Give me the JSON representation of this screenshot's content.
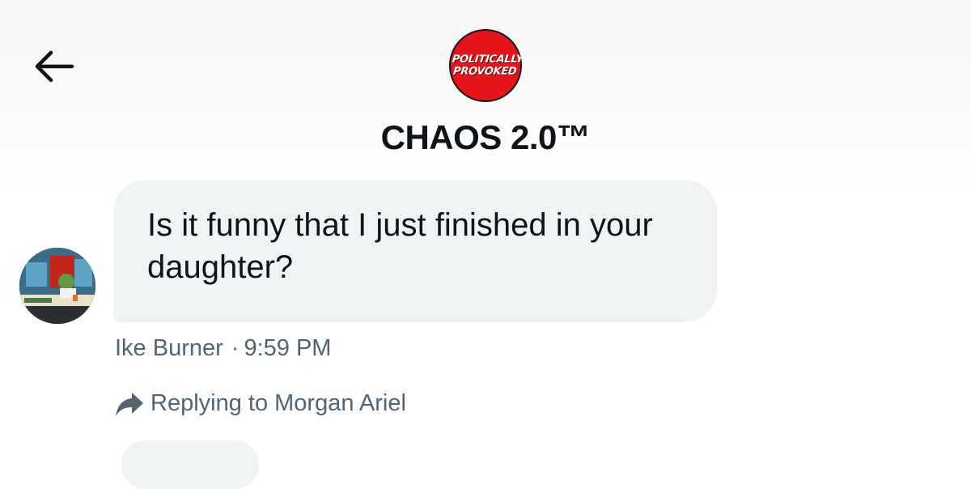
{
  "header": {
    "back_label": "Back",
    "logo_text_line1": "POLITICALLY",
    "logo_text_line2": "PROVOKED",
    "title": "CHAOS 2.0™"
  },
  "message": {
    "text": "Is it funny that I just finished in your daughter?",
    "sender": "Ike Burner",
    "separator": "·",
    "time": "9:59 PM"
  },
  "reply": {
    "label": "Replying to Morgan Ariel"
  },
  "colors": {
    "logo_red": "#e8141b",
    "bubble_bg": "#eff3f4",
    "secondary_text": "#536471",
    "primary_text": "#0f1419"
  },
  "icons": {
    "back": "arrow-left-icon",
    "reply": "reply-arrow-icon"
  }
}
